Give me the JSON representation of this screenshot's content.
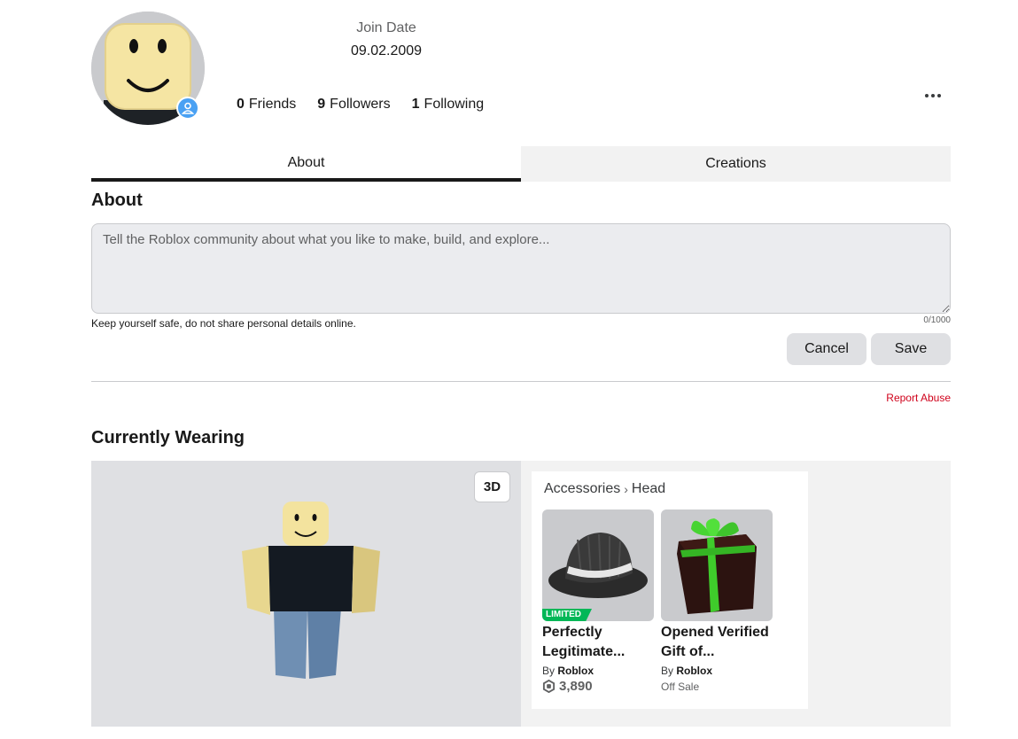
{
  "profile": {
    "join_label": "Join Date",
    "join_date": "09.02.2009",
    "friends_count": "0",
    "friends_label": "Friends",
    "followers_count": "9",
    "followers_label": "Followers",
    "following_count": "1",
    "following_label": "Following"
  },
  "tabs": [
    {
      "label": "About",
      "active": true
    },
    {
      "label": "Creations",
      "active": false
    }
  ],
  "about": {
    "title": "About",
    "placeholder": "Tell the Roblox community about what you like to make, build, and explore...",
    "hint": "Keep yourself safe, do not share personal details online.",
    "counter": "0/1000",
    "cancel_label": "Cancel",
    "save_label": "Save",
    "report_label": "Report Abuse"
  },
  "wearing": {
    "title": "Currently Wearing",
    "view_toggle": "3D",
    "breadcrumb_parent": "Accessories",
    "breadcrumb_sep": "›",
    "breadcrumb_child": "Head",
    "items": [
      {
        "name_line1": "Perfectly",
        "name_line2": "Legitimate...",
        "by": "By",
        "creator": "Roblox",
        "badge": "LIMITED",
        "price": "3,890"
      },
      {
        "name_line1": "Opened Verified",
        "name_line2": "Gift of...",
        "by": "By",
        "creator": "Roblox",
        "status": "Off Sale"
      }
    ]
  },
  "colors": {
    "accent_blue": "#4aa1f3",
    "limited_green": "#02b757",
    "report_red": "#d0021b"
  }
}
